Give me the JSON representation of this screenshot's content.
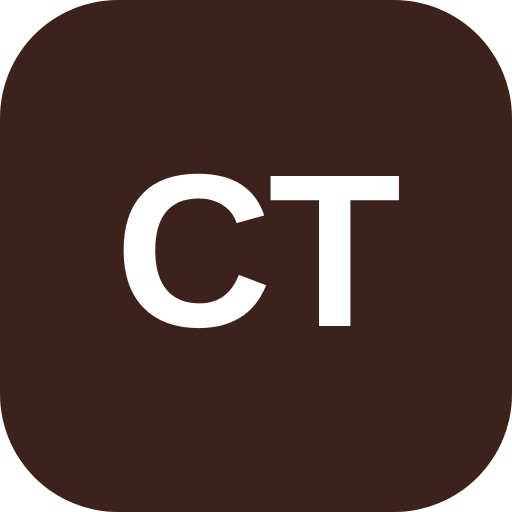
{
  "icon": {
    "monogram": "CT",
    "background_color": "#3d211b",
    "text_color": "#ffffff"
  }
}
